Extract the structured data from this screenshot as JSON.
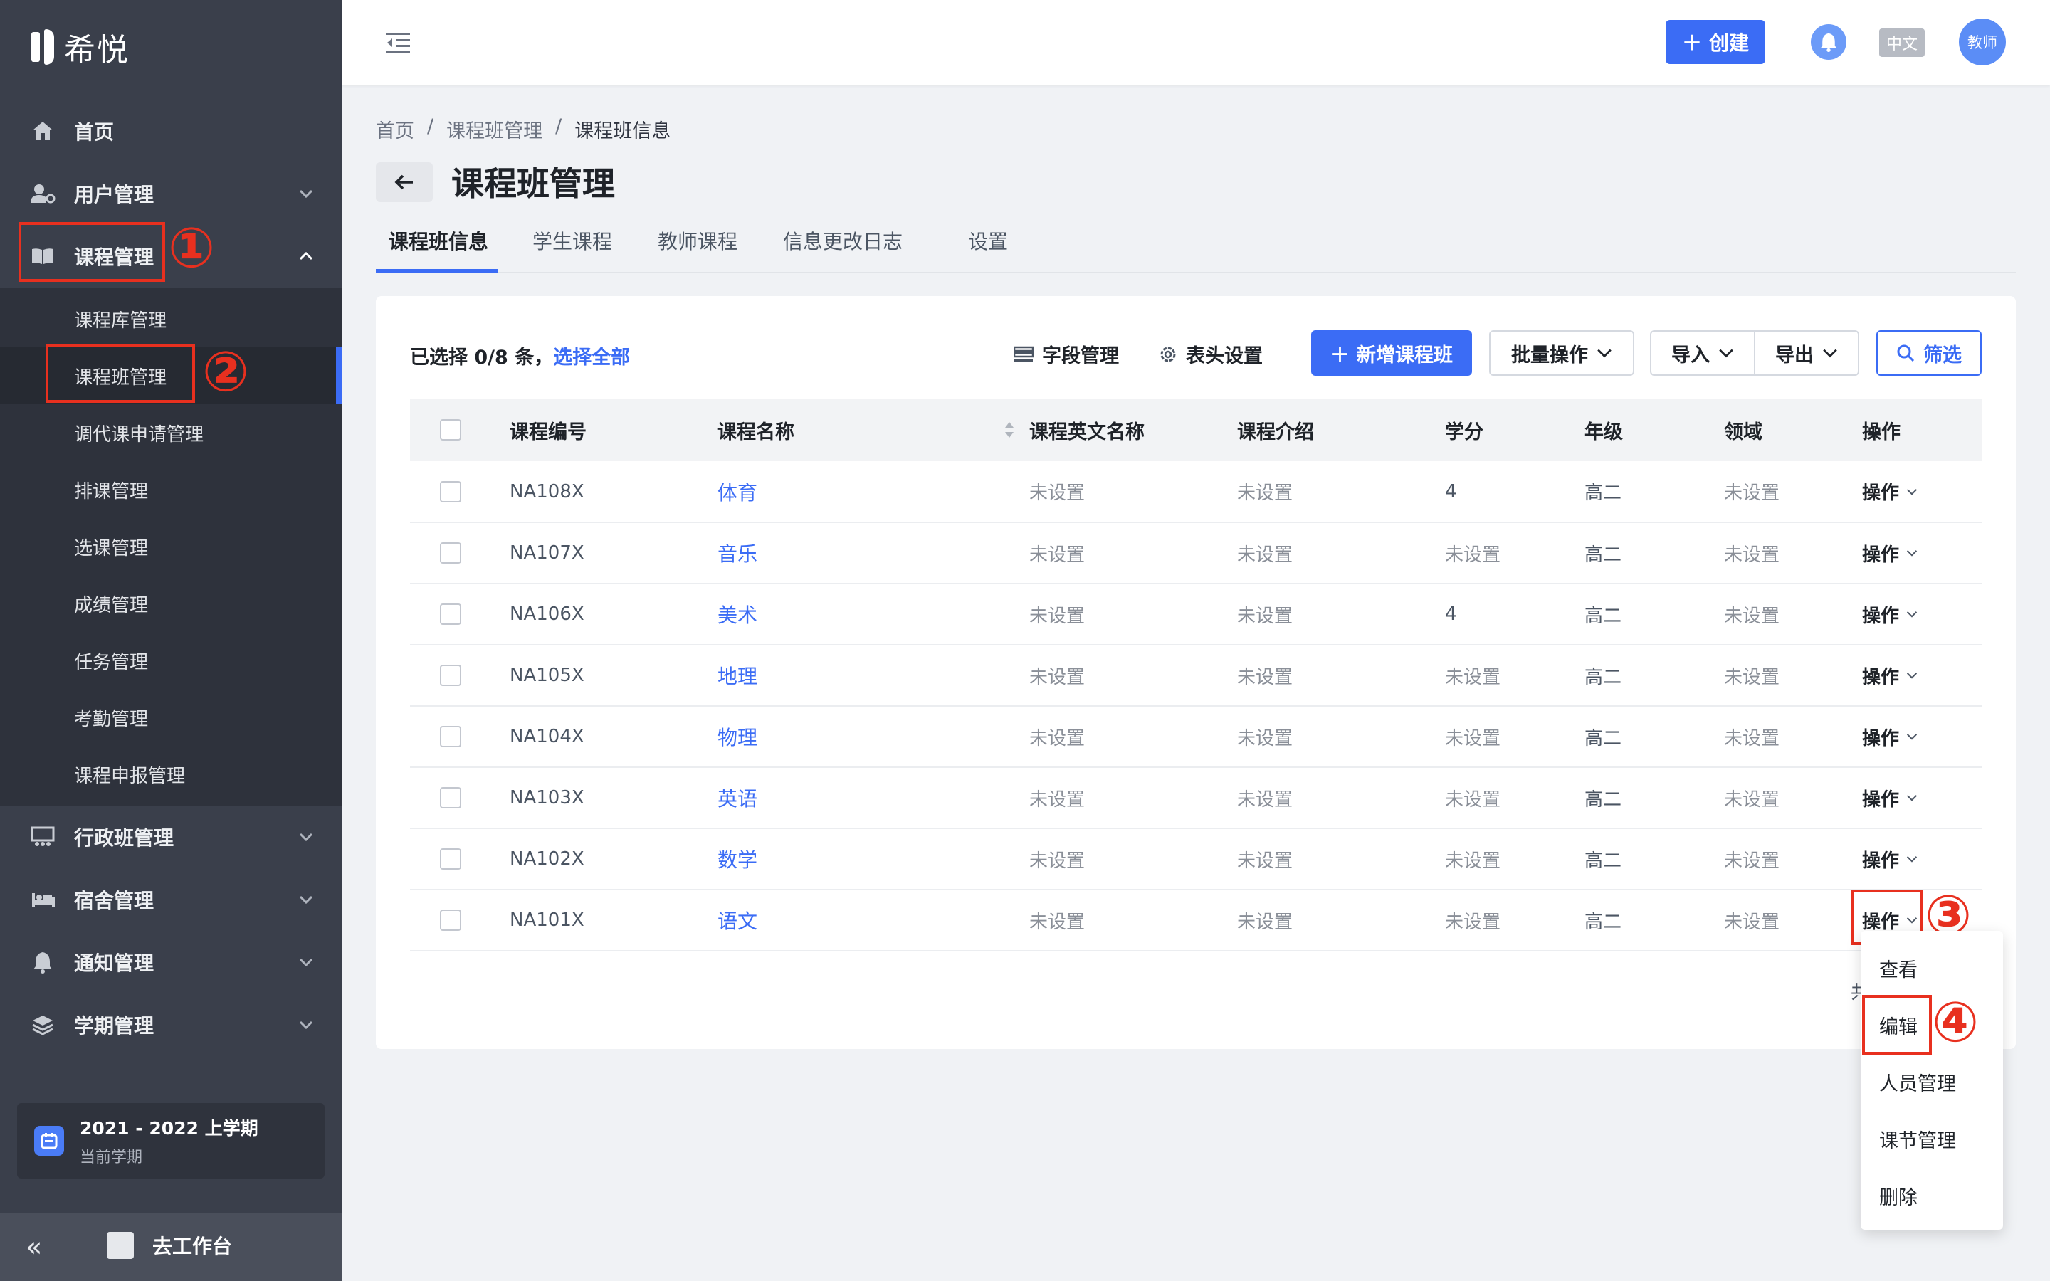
{
  "app": {
    "logo_text": "希悦"
  },
  "sidebar": {
    "items": [
      {
        "label": "首页",
        "icon": "home-icon"
      },
      {
        "label": "用户管理",
        "icon": "user-settings-icon"
      },
      {
        "label": "课程管理",
        "icon": "book-icon"
      }
    ],
    "course_submenu": [
      "课程库管理",
      "课程班管理",
      "调代课申请管理",
      "排课管理",
      "选课管理",
      "成绩管理",
      "任务管理",
      "考勤管理",
      "课程申报管理"
    ],
    "lower_items": [
      {
        "label": "行政班管理",
        "icon": "class-icon"
      },
      {
        "label": "宿舍管理",
        "icon": "bed-icon"
      },
      {
        "label": "通知管理",
        "icon": "bell-icon"
      },
      {
        "label": "学期管理",
        "icon": "layers-icon"
      }
    ],
    "term": {
      "title": "2021 - 2022 上学期",
      "subtitle": "当前学期"
    },
    "workbench_label": "去工作台",
    "collapse_label": "«"
  },
  "annotations": [
    "①",
    "②",
    "③",
    "④"
  ],
  "header": {
    "create_label": "创建",
    "lang_label": "中文",
    "avatar_label": "教师"
  },
  "breadcrumb": [
    "首页",
    "课程班管理",
    "课程班信息"
  ],
  "breadcrumb_sep": "/",
  "page_title": "课程班管理",
  "tabs": [
    "课程班信息",
    "学生课程",
    "教师课程",
    "信息更改日志",
    "设置"
  ],
  "toolbar": {
    "selection_prefix": "已选择 0/8 条，",
    "select_all": "选择全部",
    "field_manage": "字段管理",
    "header_settings": "表头设置",
    "add_class": "新增课程班",
    "batch": "批量操作",
    "import": "导入",
    "export": "导出",
    "filter": "筛选"
  },
  "table": {
    "columns": [
      "课程编号",
      "课程名称",
      "课程英文名称",
      "课程介绍",
      "学分",
      "年级",
      "领域",
      "操作"
    ],
    "rows": [
      {
        "code": "NA108X",
        "name": "体育",
        "en": "未设置",
        "intro": "未设置",
        "credit": "4",
        "grade": "高二",
        "field": "未设置",
        "op": "操作"
      },
      {
        "code": "NA107X",
        "name": "音乐",
        "en": "未设置",
        "intro": "未设置",
        "credit": "未设置",
        "grade": "高二",
        "field": "未设置",
        "op": "操作"
      },
      {
        "code": "NA106X",
        "name": "美术",
        "en": "未设置",
        "intro": "未设置",
        "credit": "4",
        "grade": "高二",
        "field": "未设置",
        "op": "操作"
      },
      {
        "code": "NA105X",
        "name": "地理",
        "en": "未设置",
        "intro": "未设置",
        "credit": "未设置",
        "grade": "高二",
        "field": "未设置",
        "op": "操作"
      },
      {
        "code": "NA104X",
        "name": "物理",
        "en": "未设置",
        "intro": "未设置",
        "credit": "未设置",
        "grade": "高二",
        "field": "未设置",
        "op": "操作"
      },
      {
        "code": "NA103X",
        "name": "英语",
        "en": "未设置",
        "intro": "未设置",
        "credit": "未设置",
        "grade": "高二",
        "field": "未设置",
        "op": "操作"
      },
      {
        "code": "NA102X",
        "name": "数学",
        "en": "未设置",
        "intro": "未设置",
        "credit": "未设置",
        "grade": "高二",
        "field": "未设置",
        "op": "操作"
      },
      {
        "code": "NA101X",
        "name": "语文",
        "en": "未设置",
        "intro": "未设置",
        "credit": "未设置",
        "grade": "高二",
        "field": "未设置",
        "op": "操作"
      }
    ],
    "footer_hint": "共"
  },
  "dropdown": [
    "查看",
    "编辑",
    "人员管理",
    "课节管理",
    "删除"
  ],
  "colors": {
    "primary": "#3b6cf5",
    "sidebar_bg": "#3a3f4b",
    "annotation": "#e8301f"
  }
}
